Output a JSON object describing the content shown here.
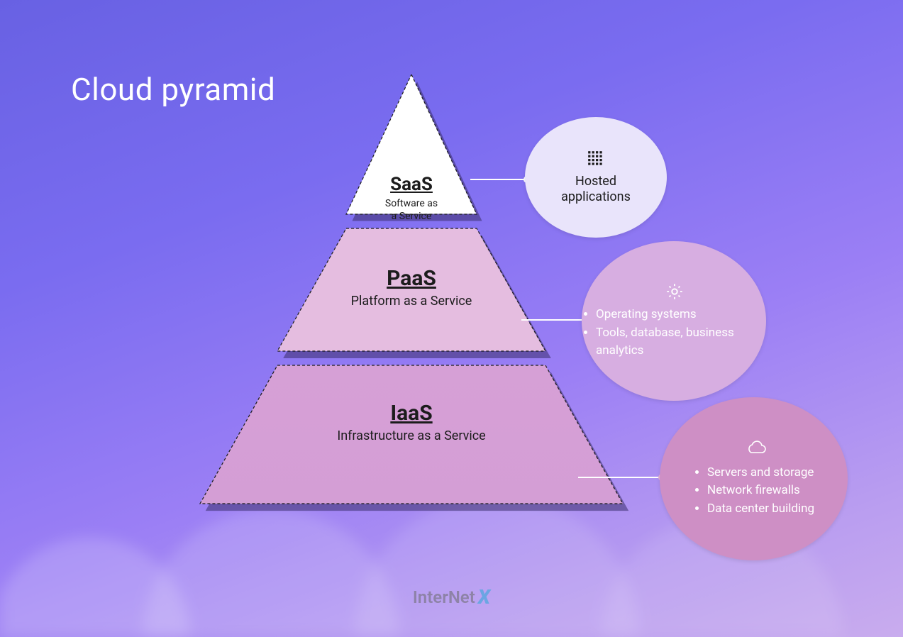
{
  "title": "Cloud pyramid",
  "tiers": {
    "saas": {
      "acronym": "SaaS",
      "desc_l1": "Software as",
      "desc_l2": "a Service",
      "desc": "Software as a Service"
    },
    "paas": {
      "acronym": "PaaS",
      "desc": "Platform as a Service"
    },
    "iaas": {
      "acronym": "IaaS",
      "desc": "Infrastructure as a Service"
    }
  },
  "callouts": {
    "saas": {
      "text_l1": "Hosted",
      "text_l2": "applications"
    },
    "paas": {
      "items": [
        "Operating systems",
        "Tools, database, business analytics"
      ]
    },
    "iaas": {
      "items": [
        "Servers and storage",
        "Network firewalls",
        "Data center building"
      ]
    }
  },
  "logo": {
    "brand": "InterNet",
    "suffix": "X"
  },
  "colors": {
    "tier_top": "#ffffff",
    "tier_mid": "#e5bde0",
    "tier_bot": "#d49ed5",
    "bubble_saas": "#e9e4fb",
    "bubble_paas": "#d7aee1",
    "bubble_iaas": "#ce8fc5",
    "bg_start": "#6861e3",
    "bg_end": "#c9acee"
  }
}
